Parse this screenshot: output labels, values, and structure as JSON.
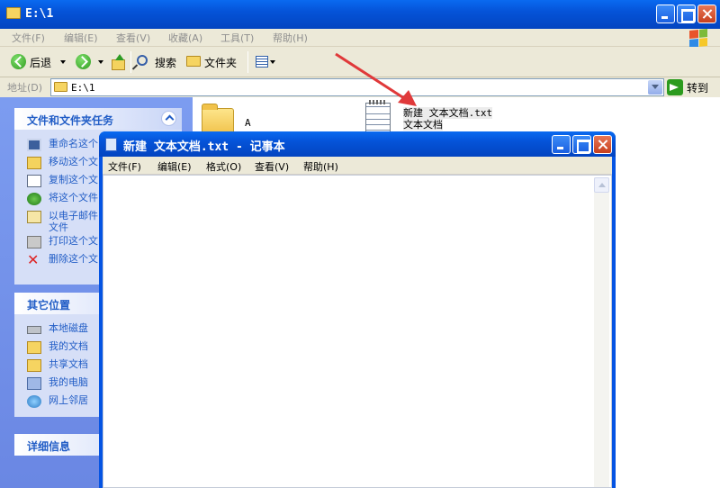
{
  "explorer": {
    "title": "E:\\1",
    "menu": [
      "文件(F)",
      "编辑(E)",
      "查看(V)",
      "收藏(A)",
      "工具(T)",
      "帮助(H)"
    ],
    "toolbar": {
      "back_label": "后退",
      "search_label": "搜索",
      "folders_label": "文件夹"
    },
    "address": {
      "label": "地址(D)",
      "value": "E:\\1",
      "go_label": "转到"
    },
    "task_panes": {
      "file_tasks": {
        "title": "文件和文件夹任务",
        "items": [
          "重命名这个",
          "移动这个文",
          "复制这个文",
          "将这个文件",
          "以电子邮件\n文件",
          "打印这个文",
          "删除这个文"
        ]
      },
      "other_places": {
        "title": "其它位置",
        "items": [
          "本地磁盘",
          "我的文档",
          "共享文档",
          "我的电脑",
          "网上邻居"
        ]
      },
      "details": {
        "title": "详细信息"
      }
    },
    "files": [
      {
        "name": "A",
        "type": "folder"
      },
      {
        "name": "新建 文本文档.txt",
        "type_label": "文本文档"
      }
    ]
  },
  "notepad": {
    "title": "新建 文本文档.txt - 记事本",
    "menu": [
      "文件(F)",
      "编辑(E)",
      "格式(O)",
      "查看(V)",
      "帮助(H)"
    ],
    "content": ""
  },
  "colors": {
    "title_blue": "#0553d8",
    "task_link": "#215dc6",
    "pane_bg": "#6a87e3",
    "arrow": "#e0393a"
  }
}
